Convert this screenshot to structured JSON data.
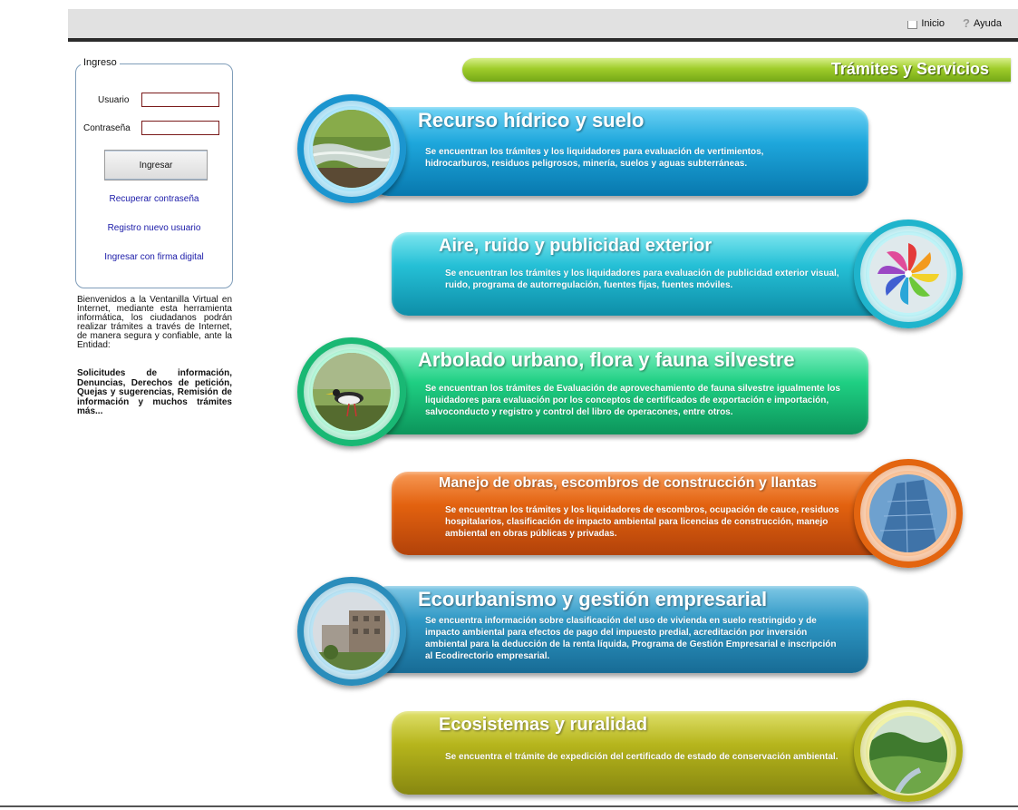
{
  "topnav": {
    "home_label": "Inicio",
    "help_label": "Ayuda"
  },
  "login": {
    "legend": "Ingreso",
    "user_label": "Usuario",
    "password_label": "Contraseña",
    "user_value": "",
    "password_value": "",
    "submit_label": "Ingresar",
    "links": [
      "Recuperar contraseña",
      "Registro nuevo usuario",
      "Ingresar con firma digital"
    ]
  },
  "welcome": {
    "text": "Bienvenidos a la Ventanilla Virtual en Internet, mediante esta herramienta informática, los ciudadanos podrán realizar trámites a través de Internet, de manera segura y confiable, ante la Entidad:",
    "bold_text": "Solicitudes de información, Denuncias, Derechos de petición, Quejas y sugerencias, Remisión de información y muchos trámites más..."
  },
  "section": {
    "title": "Trámites y Servicios",
    "accent_color": "#8dbf1f"
  },
  "services": [
    {
      "title": "Recurso hídrico y suelo",
      "description": "Se encuentran los trámites y los liquidadores para evaluación de vertimientos, hidrocarburos, residuos peligrosos, minería, suelos y aguas subterráneas.",
      "color": "#1ea7dc",
      "icon": "river-photo-icon"
    },
    {
      "title": "Aire, ruido y publicidad exterior",
      "description": "Se encuentran los trámites y los liquidadores para evaluación de publicidad exterior visual, ruido, programa de autorregulación, fuentes fijas, fuentes móviles.",
      "color": "#25c0d6",
      "icon": "pinwheel-icon"
    },
    {
      "title": "Arbolado urbano, flora y fauna silvestre",
      "description": "Se encuentran los trámites de Evaluación de aprovechamiento  de fauna silvestre igualmente los liquidadores para evaluación por los conceptos de certificados de exportación e importación, salvoconducto y registro y control del libro de operacones, entre otros.",
      "color": "#1fcf83",
      "icon": "bird-photo-icon"
    },
    {
      "title": "Manejo de obras, escombros de construcción y llantas",
      "description": "Se encuentran los trámites y los liquidadores de escombros, ocupación de cauce, residuos hospitalarios, clasificación de impacto ambiental para licencias de construcción, manejo ambiental en obras públicas y privadas.",
      "color": "#e3620f",
      "icon": "building-photo-icon"
    },
    {
      "title": "Ecourbanismo y gestión empresarial",
      "description": "Se encuentra información sobre clasificación del uso de vivienda en suelo restringido y de impacto ambiental para efectos de pago del impuesto predial, acreditación por inversión ambiental para la deducción de la renta líquida, Programa de Gestión Empresarial  e inscripción al Ecodirectorio empresarial.",
      "color": "#2e97c4",
      "icon": "city-photo-icon"
    },
    {
      "title": "Ecosistemas y ruralidad",
      "description": "Se encuentra el trámite de expedición del certificado de estado de conservación ambiental.",
      "color": "#b6b51c",
      "icon": "forest-photo-icon"
    }
  ]
}
